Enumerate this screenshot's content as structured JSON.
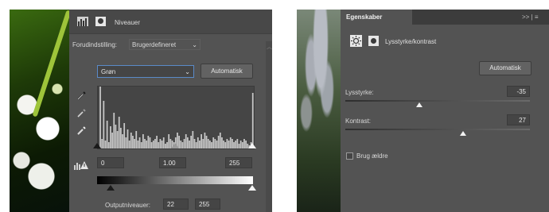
{
  "left": {
    "title": "Niveauer",
    "preset_label": "Forudindstilling:",
    "preset_value": "Brugerdefineret",
    "channel_value": "Grøn",
    "auto_button": "Automatisk",
    "input_black": "0",
    "input_gray": "1.00",
    "input_white": "255",
    "output_label": "Outputniveauer:",
    "output_black": "22",
    "output_white": "255"
  },
  "right": {
    "tab_title": "Egenskaber",
    "panel_title": "Lysstyrke/kontrast",
    "auto_button": "Automatisk",
    "brightness_label": "Lysstyrke:",
    "brightness_value": "-35",
    "contrast_label": "Kontrast:",
    "contrast_value": "27",
    "legacy_label": "Brug ældre",
    "header_icons": ">> | ≡"
  },
  "histogram": [
    2,
    80,
    12,
    60,
    10,
    35,
    8,
    28,
    20,
    45,
    30,
    22,
    40,
    26,
    18,
    32,
    14,
    24,
    10,
    20,
    16,
    12,
    22,
    10,
    14,
    8,
    18,
    12,
    10,
    16,
    14,
    8,
    10,
    12,
    16,
    8,
    12,
    10,
    14,
    6,
    8,
    18,
    12,
    10,
    8,
    14,
    20,
    16,
    10,
    8,
    12,
    18,
    14,
    10,
    16,
    22,
    12,
    8,
    14,
    10,
    18,
    12,
    20,
    16,
    12,
    10,
    8,
    14,
    12,
    10,
    16,
    20,
    14,
    10,
    8,
    12,
    10,
    14,
    12,
    8,
    10,
    12,
    6,
    10,
    8,
    12,
    10,
    6,
    4,
    8,
    70
  ]
}
